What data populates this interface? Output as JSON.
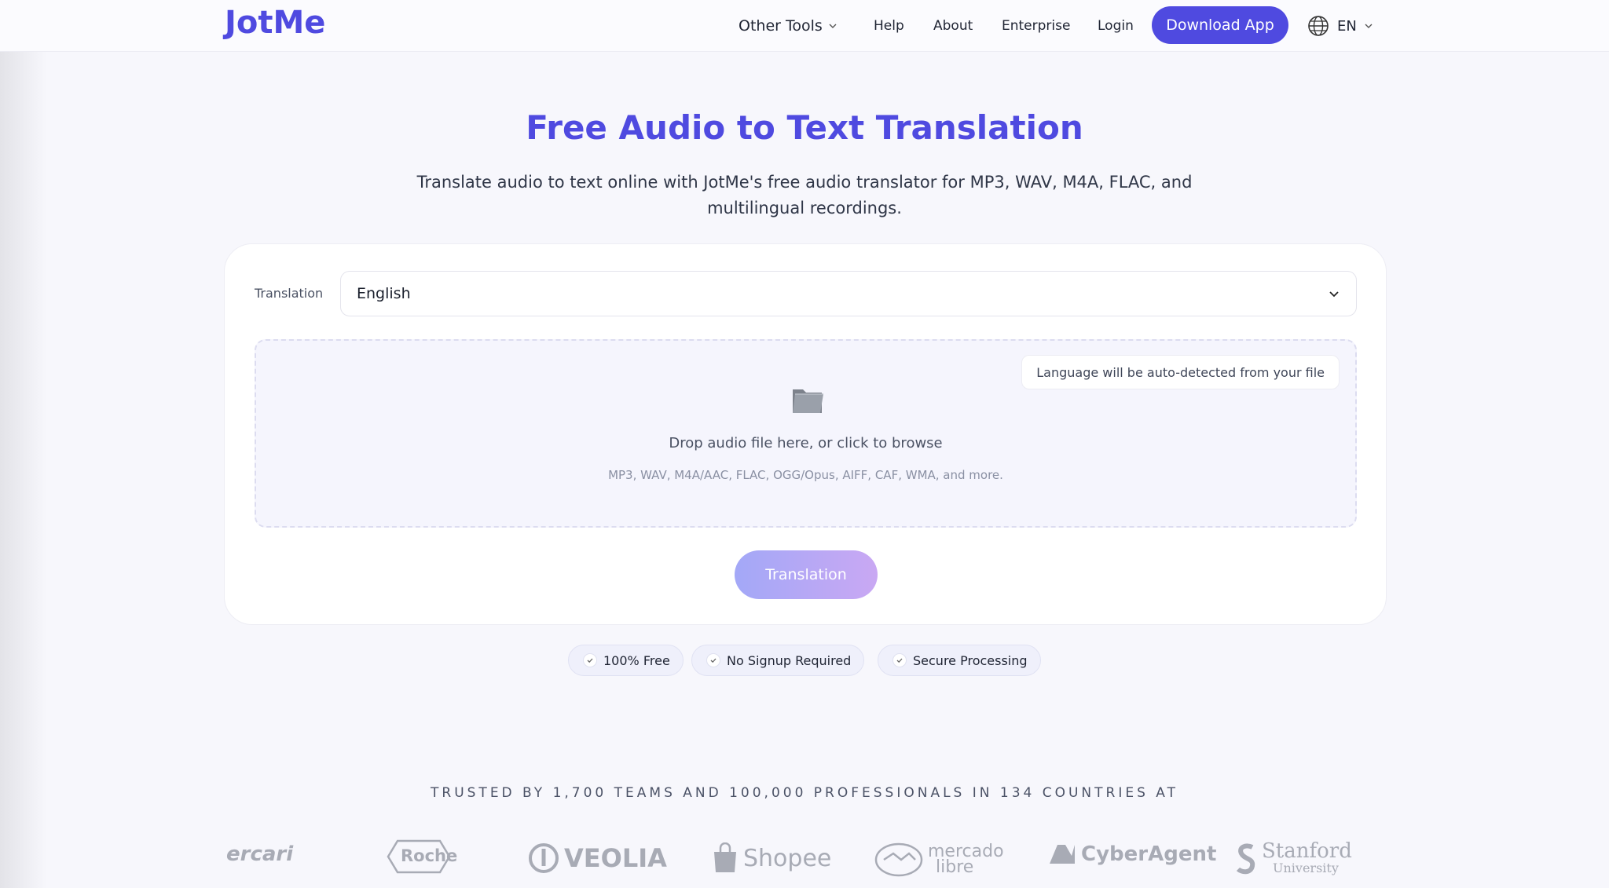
{
  "brand": {
    "name": "JotMe",
    "accent": "#4f4ae0"
  },
  "nav": {
    "items": [
      {
        "label": "Other Tools",
        "has_dropdown": true
      },
      {
        "label": "Help"
      },
      {
        "label": "About"
      },
      {
        "label": "Enterprise"
      },
      {
        "label": "Login"
      }
    ],
    "download_label": "Download App",
    "language": "EN"
  },
  "hero": {
    "title": "Free Audio to Text Translation",
    "subtitle_line1": "Translate audio to text online with JotMe's free audio translator for MP3, WAV, M4A, FLAC, and",
    "subtitle_line2": "multilingual recordings."
  },
  "tool": {
    "translation_label": "Translation",
    "selected_language": "English",
    "auto_detect_note": "Language will be auto-detected from your file",
    "drop_text": "Drop audio file here, or click to browse",
    "formats": "MP3, WAV, M4A/AAC, FLAC, OGG/Opus, AIFF, CAF, WMA, and more.",
    "submit_label": "Translation"
  },
  "badges": [
    "100% Free",
    "No Signup Required",
    "Secure Processing"
  ],
  "trusted": {
    "text": "TRUSTED BY 1,700 TEAMS AND 100,000 PROFESSIONALS IN 134 COUNTRIES AT",
    "logos": [
      "ercari",
      "Roche",
      "VEOLIA",
      "Shopee",
      "mercado",
      "libre",
      "CyberAgent",
      "Stanford",
      "University"
    ]
  },
  "icons": {
    "chevron": "chevron-down-icon",
    "globe": "globe-icon",
    "folder": "folder-icon",
    "check": "check-icon"
  }
}
